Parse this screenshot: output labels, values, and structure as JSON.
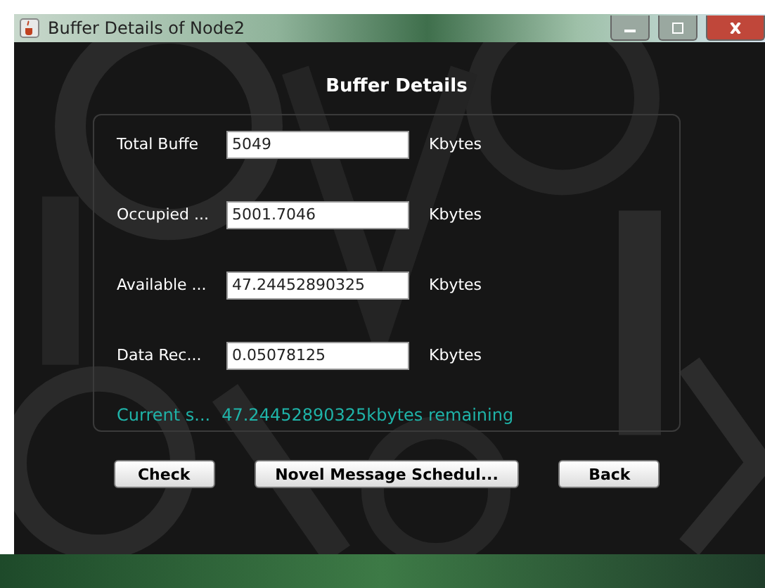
{
  "window": {
    "title": "Buffer Details of Node2"
  },
  "heading": "Buffer Details",
  "fields": [
    {
      "label": "Total Buffe",
      "value": "5049",
      "unit": "Kbytes"
    },
    {
      "label": "Occupied ...",
      "value": "5001.7046",
      "unit": "Kbytes"
    },
    {
      "label": "Available ...",
      "value": "47.24452890325",
      "unit": "Kbytes"
    },
    {
      "label": "Data Rec...",
      "value": "0.05078125",
      "unit": "Kbytes"
    }
  ],
  "status": {
    "label": "Current s...",
    "value": "47.24452890325kbytes remaining"
  },
  "buttons": [
    "Check",
    "Novel Message Schedul...",
    "Back"
  ]
}
